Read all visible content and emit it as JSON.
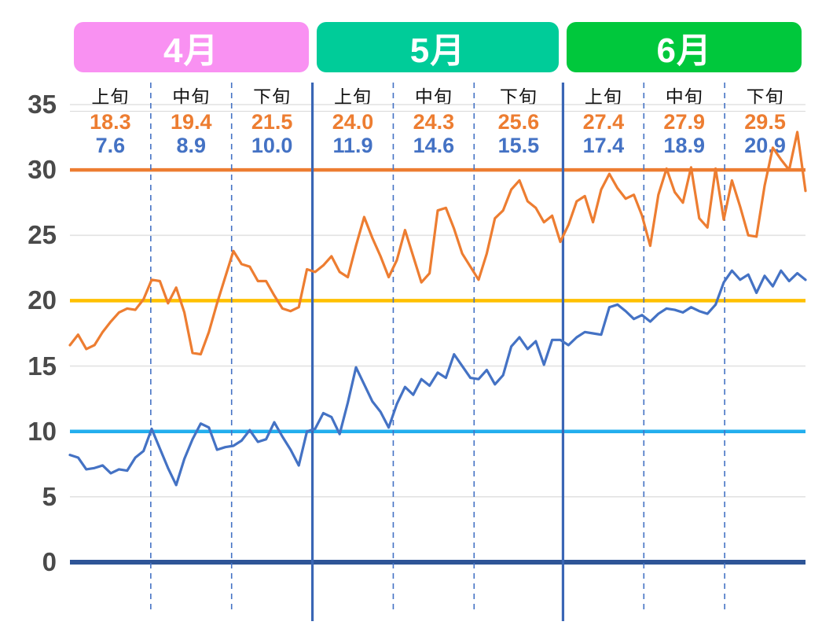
{
  "chart_data": {
    "type": "line",
    "title": "",
    "xlabel": "",
    "ylabel": "",
    "ylim": [
      0,
      35
    ],
    "yticks": [
      35,
      30,
      25,
      20,
      15,
      10,
      5,
      0
    ],
    "grid": "horizontal-light",
    "legend": "none",
    "x_count": 91,
    "x_description": "Daily values from April 1 to June 30",
    "series": [
      {
        "name": "daily-high-temperature",
        "color": "#ED7D31",
        "values": [
          16.6,
          17.4,
          16.3,
          16.6,
          17.6,
          18.4,
          19.1,
          19.4,
          19.3,
          20.1,
          21.6,
          21.5,
          19.8,
          21.0,
          19.1,
          16.0,
          15.9,
          17.6,
          19.8,
          21.8,
          23.8,
          22.8,
          22.6,
          21.5,
          21.5,
          20.4,
          19.4,
          19.2,
          19.5,
          22.4,
          22.2,
          22.7,
          23.4,
          22.2,
          21.8,
          24.2,
          26.4,
          24.8,
          23.4,
          21.8,
          23.1,
          25.4,
          23.4,
          21.4,
          22.1,
          26.9,
          27.1,
          25.5,
          23.6,
          22.6,
          21.6,
          23.6,
          26.3,
          26.9,
          28.5,
          29.2,
          27.6,
          27.1,
          26.0,
          26.5,
          24.5,
          25.8,
          27.6,
          28.0,
          26.0,
          28.5,
          29.7,
          28.6,
          27.8,
          28.1,
          26.5,
          24.2,
          28.1,
          30.1,
          28.3,
          27.5,
          30.2,
          26.3,
          25.6,
          30.1,
          26.2,
          29.2,
          27.2,
          25.0,
          24.9,
          28.8,
          31.7,
          30.8,
          30.0,
          32.9,
          28.4
        ]
      },
      {
        "name": "daily-low-temperature",
        "color": "#4472C4",
        "values": [
          8.2,
          8.0,
          7.1,
          7.2,
          7.4,
          6.8,
          7.1,
          7.0,
          8.0,
          8.5,
          10.2,
          8.7,
          7.2,
          5.9,
          7.9,
          9.4,
          10.6,
          10.3,
          8.6,
          8.8,
          8.9,
          9.3,
          10.1,
          9.2,
          9.4,
          10.7,
          9.6,
          8.6,
          7.4,
          10.0,
          10.2,
          11.4,
          11.1,
          9.8,
          12.2,
          14.9,
          13.6,
          12.3,
          11.5,
          10.3,
          12.1,
          13.4,
          12.8,
          14.0,
          13.5,
          14.5,
          14.1,
          15.9,
          15.0,
          14.1,
          14.0,
          14.7,
          13.6,
          14.3,
          16.5,
          17.2,
          16.3,
          16.9,
          15.1,
          17.0,
          17.0,
          16.6,
          17.2,
          17.6,
          17.5,
          17.4,
          19.5,
          19.7,
          19.2,
          18.6,
          18.9,
          18.4,
          19.0,
          19.4,
          19.3,
          19.1,
          19.5,
          19.2,
          19.0,
          19.7,
          21.4,
          22.3,
          21.6,
          22.0,
          20.6,
          21.9,
          21.1,
          22.3,
          21.5,
          22.1,
          21.6
        ]
      }
    ],
    "reference_lines": [
      {
        "name": "ref-line-30",
        "value": 30,
        "color": "#ED7D31"
      },
      {
        "name": "ref-line-20",
        "value": 20,
        "color": "#FFC000"
      },
      {
        "name": "ref-line-10",
        "value": 10,
        "color": "#23AEEE"
      },
      {
        "name": "ref-line-0",
        "value": 0,
        "color": "#2E5597"
      }
    ],
    "months": [
      {
        "label": "4月",
        "color": "#F991F2",
        "start_day": 0,
        "days": 30
      },
      {
        "label": "5月",
        "color": "#00CC99",
        "start_day": 30,
        "days": 31
      },
      {
        "label": "6月",
        "color": "#00C83C",
        "start_day": 61,
        "days": 30
      }
    ],
    "decades": [
      {
        "name": "上旬",
        "high": "18.3",
        "low": "7.6",
        "start_day": 0,
        "days": 10
      },
      {
        "name": "中旬",
        "high": "19.4",
        "low": "8.9",
        "start_day": 10,
        "days": 10
      },
      {
        "name": "下旬",
        "high": "21.5",
        "low": "10.0",
        "start_day": 20,
        "days": 10
      },
      {
        "name": "上旬",
        "high": "24.0",
        "low": "11.9",
        "start_day": 30,
        "days": 10
      },
      {
        "name": "中旬",
        "high": "24.3",
        "low": "14.6",
        "start_day": 40,
        "days": 10
      },
      {
        "name": "下旬",
        "high": "25.6",
        "low": "15.5",
        "start_day": 50,
        "days": 11
      },
      {
        "name": "上旬",
        "high": "27.4",
        "low": "17.4",
        "start_day": 61,
        "days": 10
      },
      {
        "name": "中旬",
        "high": "27.9",
        "low": "18.9",
        "start_day": 71,
        "days": 10
      },
      {
        "name": "下旬",
        "high": "29.5",
        "low": "20.9",
        "start_day": 81,
        "days": 10
      }
    ]
  }
}
